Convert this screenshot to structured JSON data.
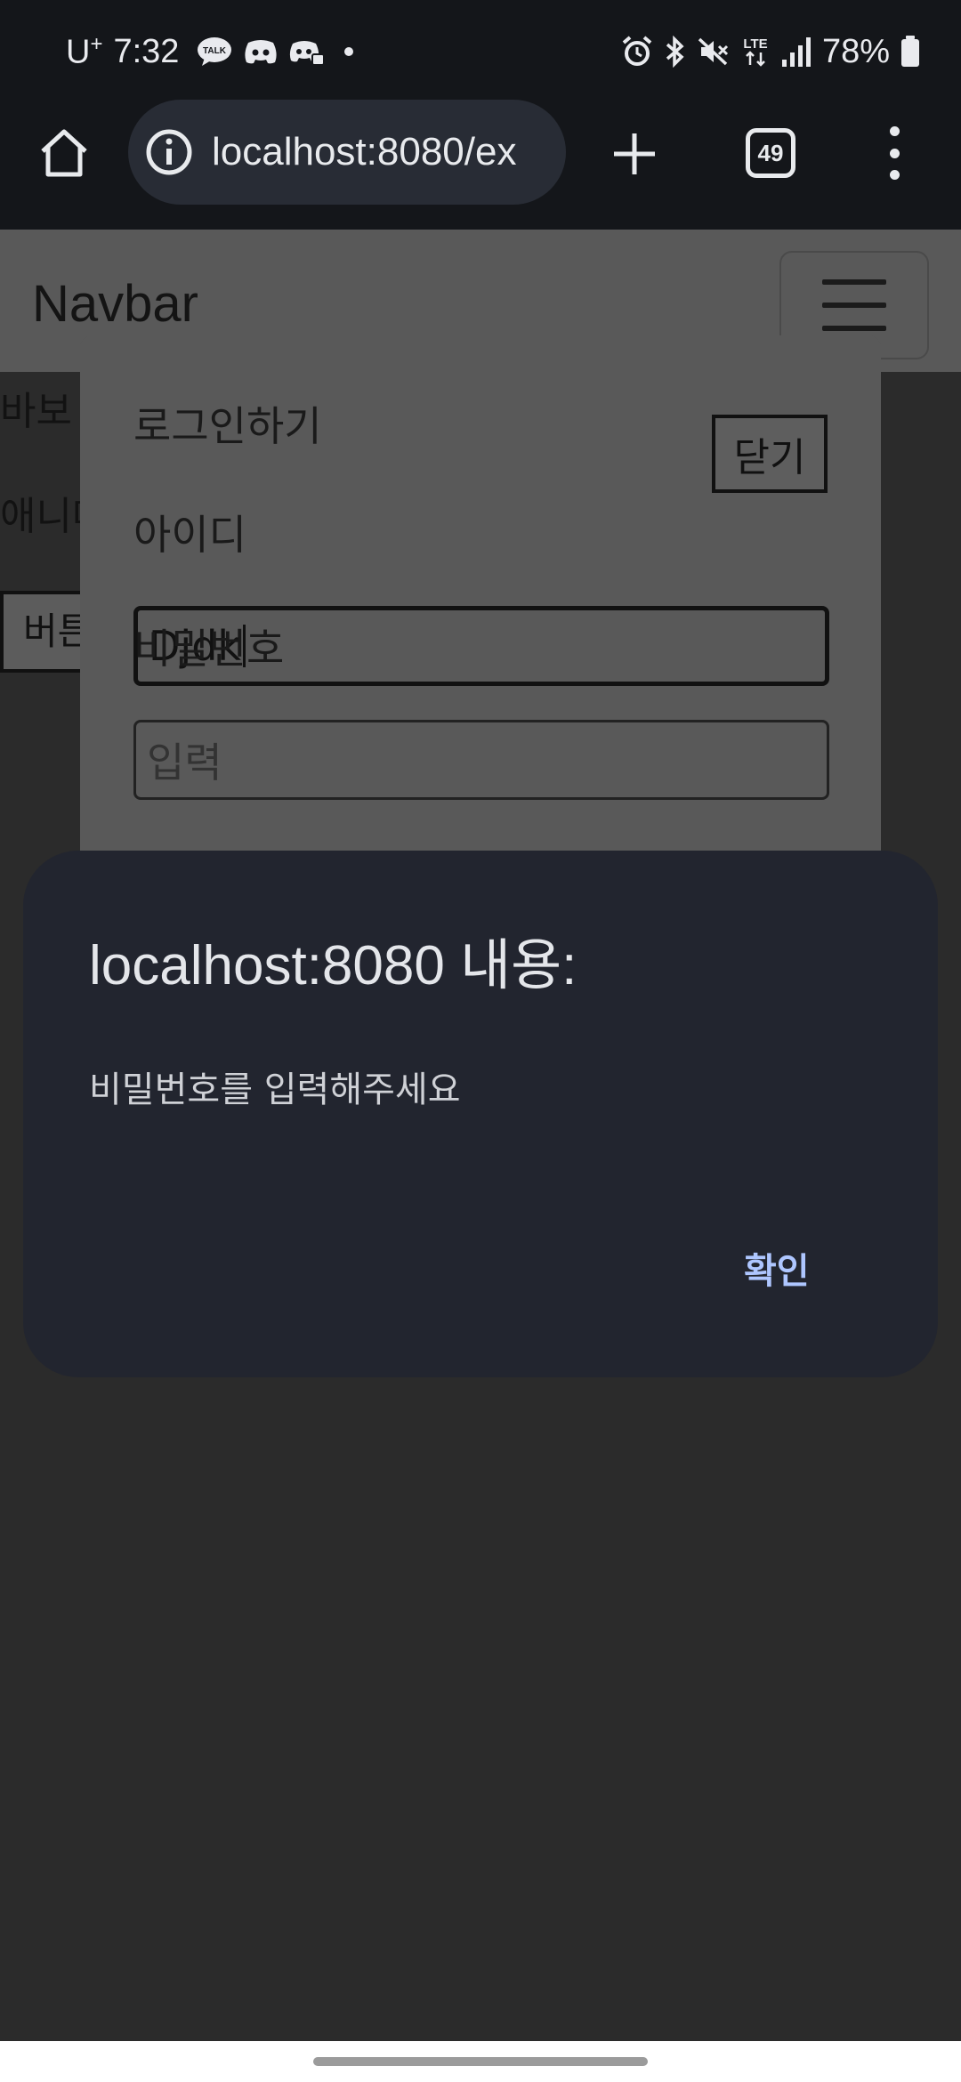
{
  "status_bar": {
    "carrier": "U",
    "carrier_plus": "+",
    "time": "7:32",
    "left_icons": [
      "kakaotalk-icon",
      "discord-icon",
      "discord-icon",
      "dot-icon"
    ],
    "right_icons": [
      "alarm-icon",
      "bluetooth-icon",
      "mute-icon",
      "lte-icon",
      "signal-icon"
    ],
    "lte_label": "LTE",
    "battery_percent": "78%"
  },
  "browser": {
    "url": "localhost:8080/ex",
    "tab_count": "49"
  },
  "page": {
    "brand": "Navbar",
    "text1": "바보",
    "text2": "애니메",
    "button": "버튼"
  },
  "modal": {
    "title": "로그인하기",
    "close_label": "닫기",
    "id_label": "아이디",
    "id_value": "Djdk",
    "password_label": "비밀번호",
    "password_placeholder": "입력"
  },
  "alert": {
    "title": "localhost:8080 내용:",
    "message": "비밀번호를 입력해주세요",
    "ok_label": "확인",
    "accent_color": "#aec6ff"
  }
}
